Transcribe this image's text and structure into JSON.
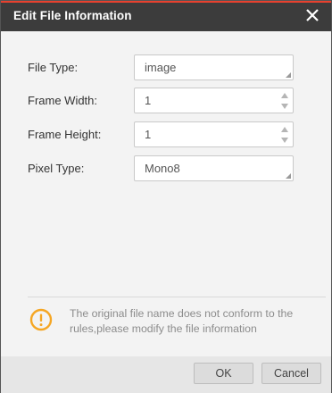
{
  "dialog": {
    "title": "Edit File Information",
    "close_icon": "close-icon",
    "accent_color": "#e7412f",
    "titlebar_color": "#3c3c3c"
  },
  "form": {
    "file_type": {
      "label": "File Type:",
      "value": "image"
    },
    "frame_width": {
      "label": "Frame Width:",
      "value": "1"
    },
    "frame_height": {
      "label": "Frame Height:",
      "value": "1"
    },
    "pixel_type": {
      "label": "Pixel Type:",
      "value": "Mono8"
    }
  },
  "notice": {
    "icon": "warning-icon",
    "icon_color": "#f5a623",
    "message": "The original file name does not conform to the rules,please modify the file information"
  },
  "buttons": {
    "ok": "OK",
    "cancel": "Cancel"
  }
}
